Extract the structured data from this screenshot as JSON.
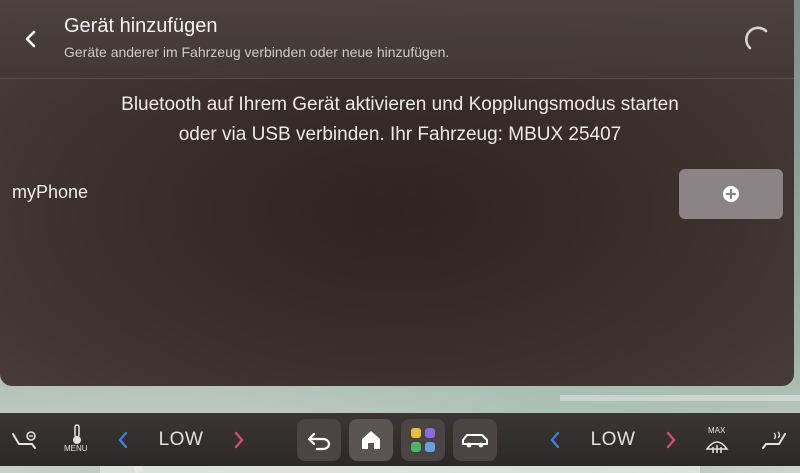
{
  "header": {
    "title": "Gerät hinzufügen",
    "subtitle": "Geräte anderer im Fahrzeug verbinden oder neue hinzufügen."
  },
  "instructions": {
    "line1": "Bluetooth auf Ihrem Gerät aktivieren und Kopplungsmodus starten",
    "line2": "oder via USB verbinden. Ihr Fahrzeug: MBUX 25407"
  },
  "device": {
    "name": "myPhone"
  },
  "bottom_bar": {
    "menu_label": "MENU",
    "left_temp": "LOW",
    "right_temp": "LOW",
    "defrost_label": "MAX"
  },
  "colors": {
    "accent_blue": "#3f7be0",
    "accent_pink": "#e0457b",
    "add_button": "#8a8487"
  },
  "icons": [
    "back-icon",
    "loading-spinner-icon",
    "add-icon",
    "seat-heating-icon",
    "climate-temperature-icon",
    "chevron-left-icon",
    "chevron-right-icon",
    "return-icon",
    "home-icon",
    "apps-icon",
    "car-icon",
    "defrost-icon",
    "seat-ventilation-icon"
  ]
}
